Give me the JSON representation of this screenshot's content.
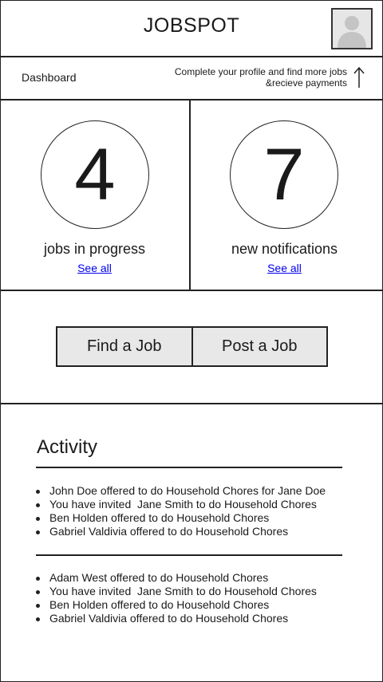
{
  "header": {
    "title": "JOBSPOT",
    "avatar_icon": "user-silhouette-icon"
  },
  "subbar": {
    "breadcrumb": "Dashboard",
    "profile_message_line1": "Complete your profile and find more jobs",
    "profile_message_line2": "&recieve payments",
    "arrow_icon": "up-arrow-icon"
  },
  "stats": {
    "jobs": {
      "count": "4",
      "label": "jobs in progress",
      "link": "See all"
    },
    "notifications": {
      "count": "7",
      "label": "new notifications",
      "link": "See all"
    }
  },
  "actions": {
    "find_label": "Find a Job",
    "post_label": "Post a Job"
  },
  "activity": {
    "title": "Activity",
    "group1": [
      "John Doe offered to do Household Chores for Jane Doe",
      "You have invited  Jane Smith to do Household Chores",
      "Ben Holden offered to do Household Chores",
      "Gabriel Valdivia offered to do Household Chores"
    ],
    "group2": [
      "Adam West offered to do Household Chores",
      "You have invited  Jane Smith to do Household Chores",
      "Ben Holden offered to do Household Chores",
      "Gabriel Valdivia offered to do Household Chores"
    ]
  }
}
